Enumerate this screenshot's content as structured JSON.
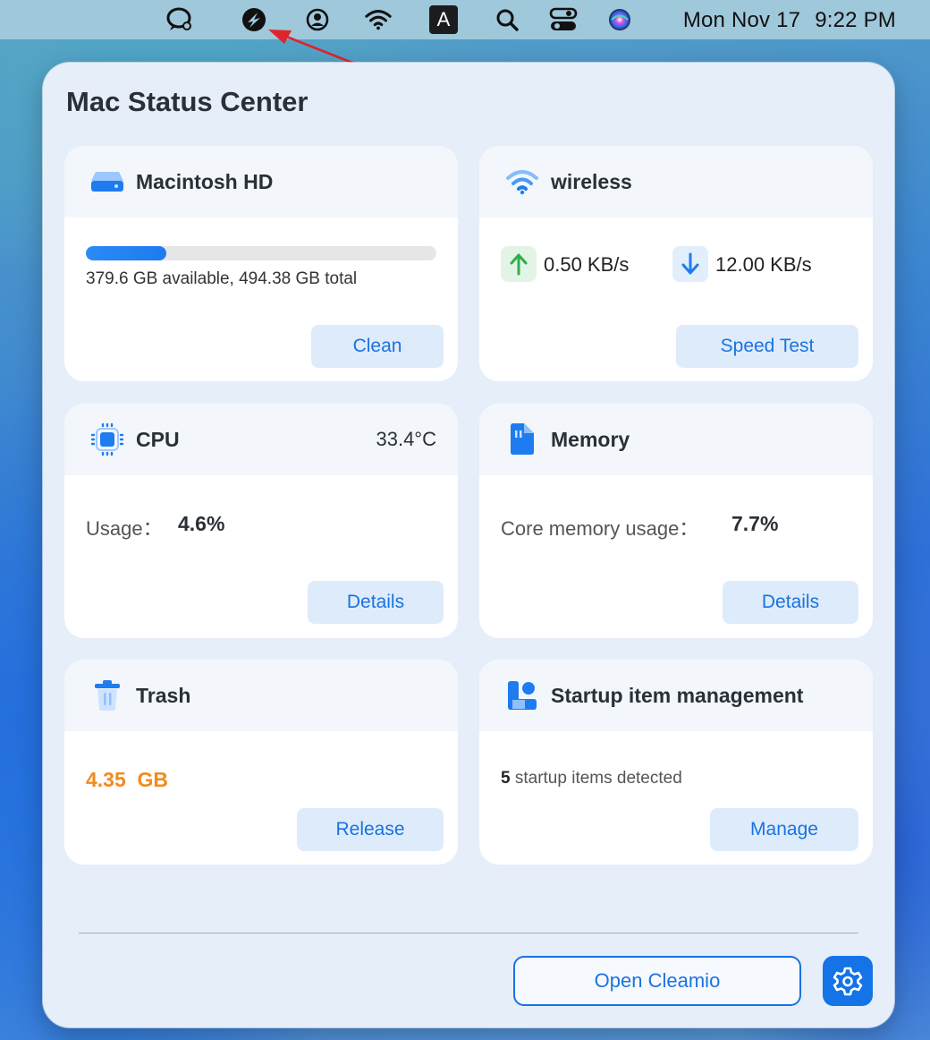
{
  "menubar": {
    "icons": [
      "chat-bubble-icon",
      "cleamio-icon",
      "user-circle-icon",
      "wifi-icon",
      "input-source-icon",
      "spotlight-search-icon",
      "control-center-icon",
      "siri-icon"
    ],
    "input_source_letter": "A",
    "date": "Mon Nov 17",
    "time": "9:22 PM"
  },
  "panel": {
    "title": "Mac Status Center"
  },
  "disk": {
    "title": "Macintosh HD",
    "usage_fraction": 0.23,
    "summary": "379.6 GB available, 494.38 GB total",
    "button": "Clean"
  },
  "network": {
    "title": "wireless",
    "upload": "0.50 KB/s",
    "download": "12.00 KB/s",
    "button": "Speed Test"
  },
  "cpu": {
    "title": "CPU",
    "temperature": "33.4°C",
    "usage_label": "Usage：",
    "usage_value": "4.6%",
    "button": "Details"
  },
  "memory": {
    "title": "Memory",
    "usage_label": "Core memory usage：",
    "usage_value": "7.7%",
    "button": "Details"
  },
  "trash": {
    "title": "Trash",
    "size": "4.35  GB",
    "button": "Release"
  },
  "startup": {
    "title": "Startup item management",
    "count": "5",
    "detected_text": " startup items detected",
    "button": "Manage"
  },
  "footer": {
    "open_button": "Open Cleamio",
    "settings_icon": "gear-icon"
  },
  "colors": {
    "accent": "#1a73e0",
    "button_bg": "#deebfb",
    "trash_value": "#f28a1e",
    "upload_green": "#2fae4c",
    "annotation_arrow": "#e0242a"
  }
}
